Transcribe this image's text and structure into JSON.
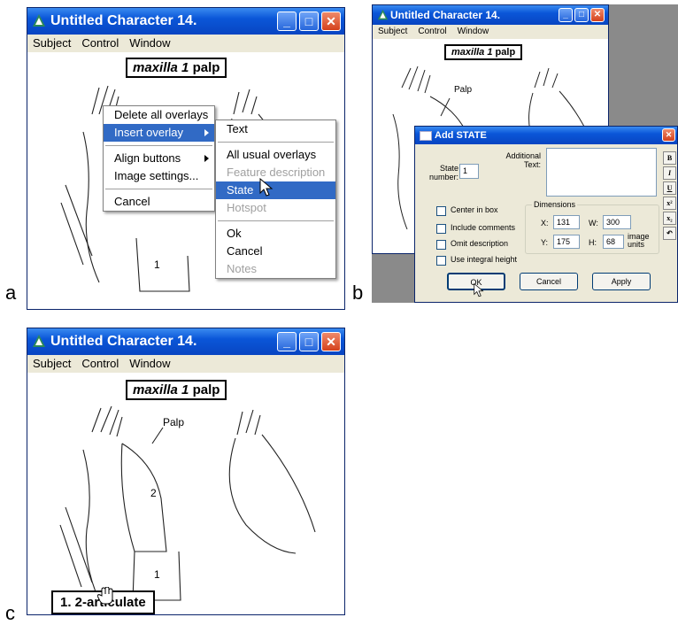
{
  "panel_labels": {
    "a": "a",
    "b": "b",
    "c": "c"
  },
  "window": {
    "title": "Untitled Character 14.",
    "menu": [
      "Subject",
      "Control",
      "Window"
    ],
    "caption_italic": "maxilla 1",
    "caption_plain": "palp"
  },
  "drawing_labels": {
    "palp": "Palp",
    "seg1": "1",
    "seg2": "2"
  },
  "context_menu": {
    "items": [
      "Delete all overlays",
      "Insert overlay",
      "Align buttons",
      "Image settings...",
      "Cancel"
    ]
  },
  "submenu": {
    "items": [
      "Text",
      "All usual overlays",
      "Feature description",
      "State",
      "Hotspot",
      "Ok",
      "Cancel",
      "Notes"
    ]
  },
  "dialog": {
    "title": "Add STATE",
    "state_number_label": "State number:",
    "state_number_value": "1",
    "additional_text_label": "Additional Text:",
    "checkboxes": [
      "Center in box",
      "Include comments",
      "Omit description",
      "Use integral height"
    ],
    "dimensions_label": "Dimensions",
    "x_label": "X:",
    "x_value": "131",
    "w_label": "W:",
    "w_value": "300",
    "y_label": "Y:",
    "y_value": "175",
    "h_label": "H:",
    "h_value": "68",
    "units_label": "image units",
    "ok_label": "OK",
    "cancel_label": "Cancel",
    "apply_label": "Apply",
    "format_buttons": [
      "B",
      "I",
      "U",
      "x²",
      "x₂",
      "↶"
    ]
  },
  "state_overlay": {
    "text": "1. 2-articulate"
  },
  "colors": {
    "title_blue": "#0a56d8",
    "menu_bg": "#ece9d8",
    "selection": "#316ac5"
  }
}
